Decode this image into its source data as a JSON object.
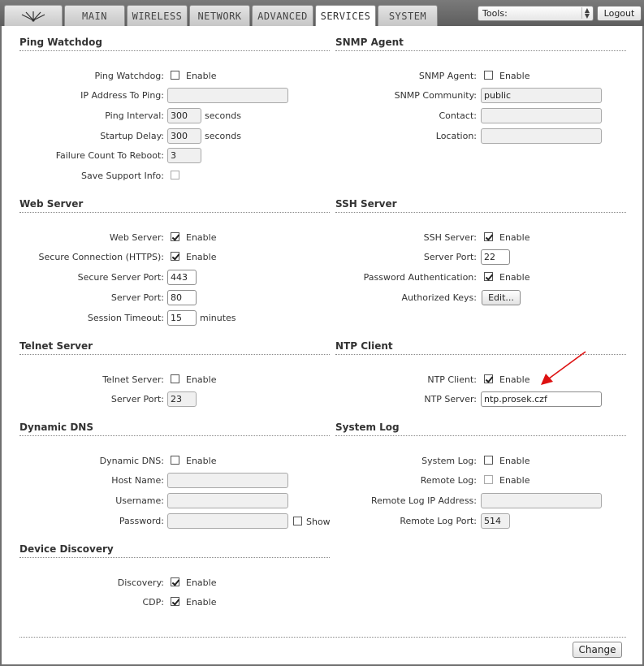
{
  "nav": {
    "tabs": [
      "MAIN",
      "WIRELESS",
      "NETWORK",
      "ADVANCED",
      "SERVICES",
      "SYSTEM"
    ],
    "active_tab": "SERVICES",
    "tools_value": "Tools:",
    "logout_label": "Logout"
  },
  "common": {
    "enable": "Enable",
    "seconds": "seconds",
    "minutes": "minutes",
    "show": "Show"
  },
  "ping": {
    "title": "Ping Watchdog",
    "ping_watchdog_label": "Ping Watchdog:",
    "ip_label": "IP Address To Ping:",
    "ip_value": "",
    "interval_label": "Ping Interval:",
    "interval_value": "300",
    "startup_label": "Startup Delay:",
    "startup_value": "300",
    "failure_label": "Failure Count To Reboot:",
    "failure_value": "3",
    "support_label": "Save Support Info:"
  },
  "snmp": {
    "title": "SNMP Agent",
    "agent_label": "SNMP Agent:",
    "community_label": "SNMP Community:",
    "community_value": "public",
    "contact_label": "Contact:",
    "contact_value": "",
    "location_label": "Location:",
    "location_value": ""
  },
  "web": {
    "title": "Web Server",
    "server_label": "Web Server:",
    "https_label": "Secure Connection (HTTPS):",
    "secure_port_label": "Secure Server Port:",
    "secure_port_value": "443",
    "port_label": "Server Port:",
    "port_value": "80",
    "timeout_label": "Session Timeout:",
    "timeout_value": "15"
  },
  "ssh": {
    "title": "SSH Server",
    "server_label": "SSH Server:",
    "port_label": "Server Port:",
    "port_value": "22",
    "password_label": "Password Authentication:",
    "keys_label": "Authorized Keys:",
    "edit_label": "Edit..."
  },
  "telnet": {
    "title": "Telnet Server",
    "server_label": "Telnet Server:",
    "port_label": "Server Port:",
    "port_value": "23"
  },
  "ntp": {
    "title": "NTP Client",
    "client_label": "NTP Client:",
    "server_label": "NTP Server:",
    "server_value": "ntp.prosek.czf"
  },
  "ddns": {
    "title": "Dynamic DNS",
    "dns_label": "Dynamic DNS:",
    "host_label": "Host Name:",
    "host_value": "",
    "user_label": "Username:",
    "user_value": "",
    "pass_label": "Password:",
    "pass_value": ""
  },
  "syslog": {
    "title": "System Log",
    "log_label": "System Log:",
    "remote_label": "Remote Log:",
    "remote_ip_label": "Remote Log IP Address:",
    "remote_ip_value": "",
    "remote_port_label": "Remote Log Port:",
    "remote_port_value": "514"
  },
  "discovery": {
    "title": "Device Discovery",
    "discovery_label": "Discovery:",
    "cdp_label": "CDP:"
  },
  "footer": {
    "change_label": "Change"
  },
  "colors": {
    "annotation_arrow": "#dd1111"
  }
}
